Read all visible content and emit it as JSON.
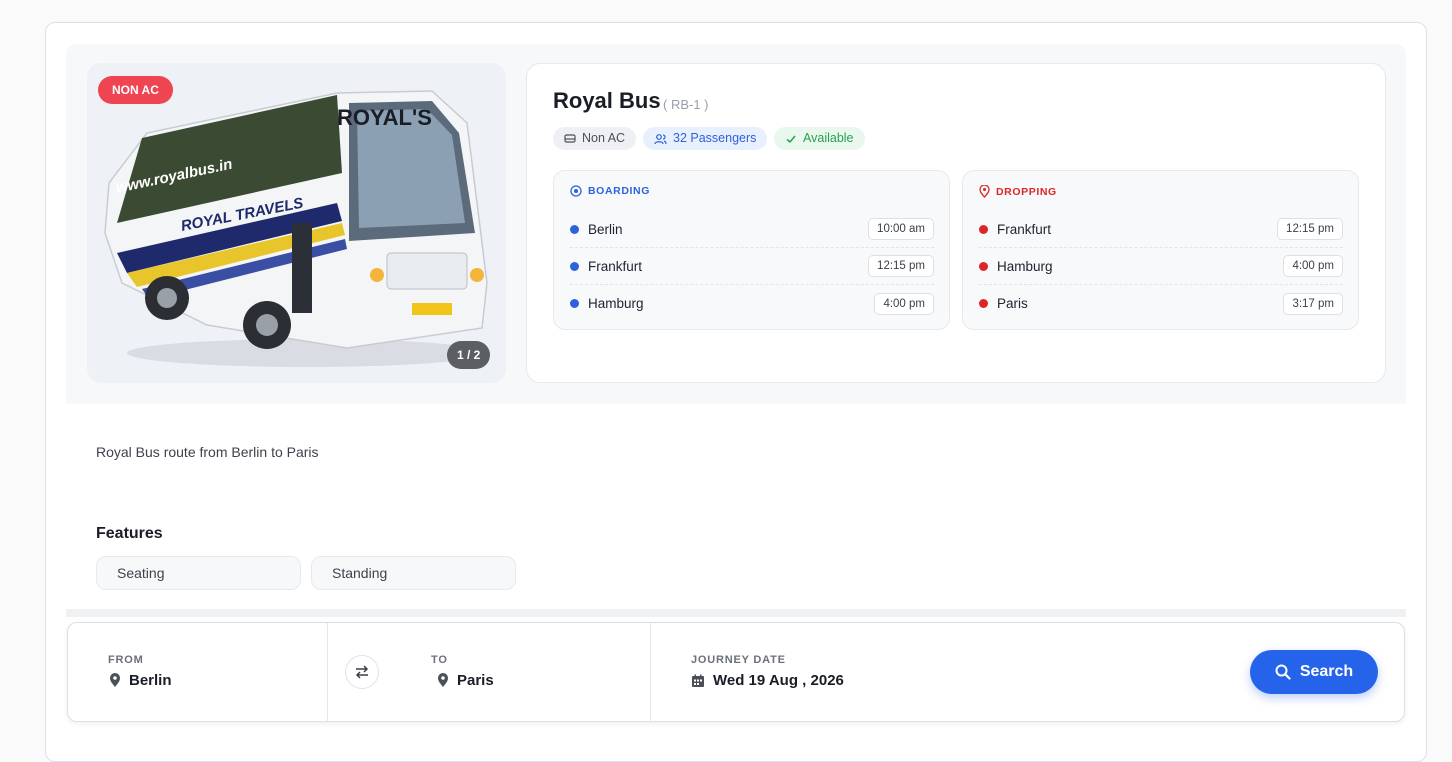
{
  "badge": "NON AC",
  "image_counter": "1 / 2",
  "image_alt_text": {
    "brand": "ROYAL'S",
    "side_text": "ROYAL TRAVELS",
    "window_text": "www.royalbus.in"
  },
  "bus": {
    "name": "Royal Bus",
    "code": "( RB-1 )"
  },
  "chips": {
    "type": "Non AC",
    "passengers": "32 Passengers",
    "status": "Available"
  },
  "boarding": {
    "label": "BOARDING",
    "stops": [
      {
        "name": "Berlin",
        "time": "10:00 am"
      },
      {
        "name": "Frankfurt",
        "time": "12:15 pm"
      },
      {
        "name": "Hamburg",
        "time": "4:00 pm"
      }
    ]
  },
  "dropping": {
    "label": "DROPPING",
    "stops": [
      {
        "name": "Frankfurt",
        "time": "12:15 pm"
      },
      {
        "name": "Hamburg",
        "time": "4:00 pm"
      },
      {
        "name": "Paris",
        "time": "3:17 pm"
      }
    ]
  },
  "description": "Royal Bus route from Berlin to Paris",
  "features": {
    "heading": "Features",
    "items": [
      "Seating",
      "Standing"
    ]
  },
  "search": {
    "from_label": "FROM",
    "from_value": "Berlin",
    "to_label": "TO",
    "to_value": "Paris",
    "date_label": "JOURNEY DATE",
    "date_value": "Wed 19 Aug , 2026",
    "button_label": "Search"
  },
  "colors": {
    "accent": "#2563eb",
    "badge_red": "#ef4452",
    "boarding_blue": "#2e62d9",
    "dropping_red": "#dc2626",
    "available_green": "#27a24f"
  }
}
